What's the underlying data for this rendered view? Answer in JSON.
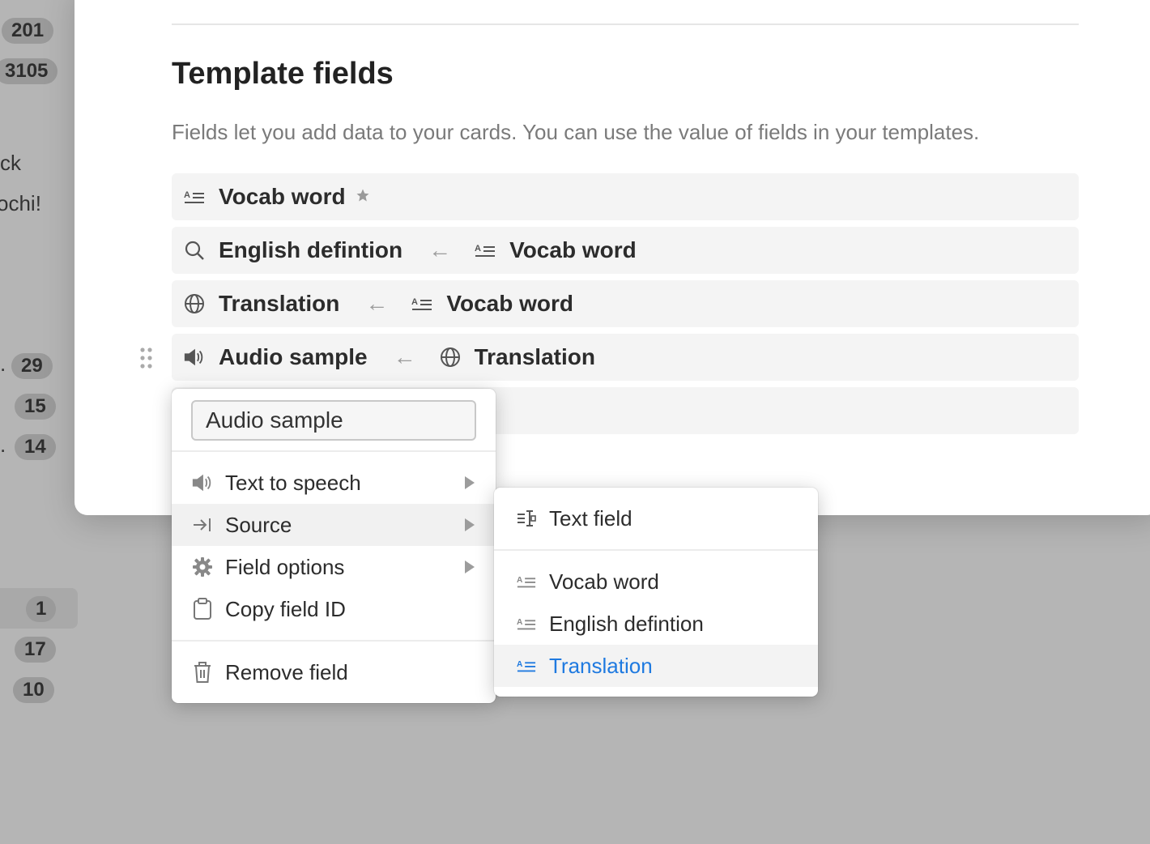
{
  "sidebar_badges": [
    {
      "value": "201"
    },
    {
      "value": "3105"
    },
    {
      "value": "29"
    },
    {
      "value": "15"
    },
    {
      "value": "14"
    },
    {
      "value": "1"
    },
    {
      "value": "17"
    },
    {
      "value": "10"
    }
  ],
  "sidebar_texts": [
    "ck",
    "ochi!",
    ".",
    "."
  ],
  "section": {
    "title": "Template fields",
    "description": "Fields let you add data to your cards. You can use the value of fields in your templates."
  },
  "fields": [
    {
      "name": "Vocab word",
      "icon": "text-lines-icon",
      "starred": true
    },
    {
      "name": "English defintion",
      "icon": "search-icon",
      "source": "Vocab word",
      "source_icon": "text-lines-icon"
    },
    {
      "name": "Translation",
      "icon": "globe-icon",
      "source": "Vocab word",
      "source_icon": "text-lines-icon"
    },
    {
      "name": "Audio sample",
      "icon": "speaker-icon",
      "source": "Translation",
      "source_icon": "globe-icon"
    }
  ],
  "arrow_glyph": "←",
  "context_menu": {
    "name_input_value": "Audio sample",
    "items": [
      {
        "label": "Text to speech",
        "icon": "speaker-icon",
        "has_submenu": true
      },
      {
        "label": "Source",
        "icon": "source-arrow-icon",
        "has_submenu": true,
        "active": true
      },
      {
        "label": "Field options",
        "icon": "gear-icon",
        "has_submenu": true
      },
      {
        "label": "Copy field ID",
        "icon": "clipboard-icon",
        "has_submenu": false
      }
    ],
    "remove_label": "Remove field"
  },
  "source_submenu": {
    "items": [
      {
        "label": "Text field",
        "icon": "text-cursor-icon"
      },
      {
        "label": "Vocab word",
        "icon": "text-lines-icon"
      },
      {
        "label": "English defintion",
        "icon": "text-lines-icon"
      },
      {
        "label": "Translation",
        "icon": "text-lines-icon",
        "selected": true
      }
    ]
  },
  "colors": {
    "accent": "#1f7ae0",
    "overlay": "#b5b5b5"
  }
}
